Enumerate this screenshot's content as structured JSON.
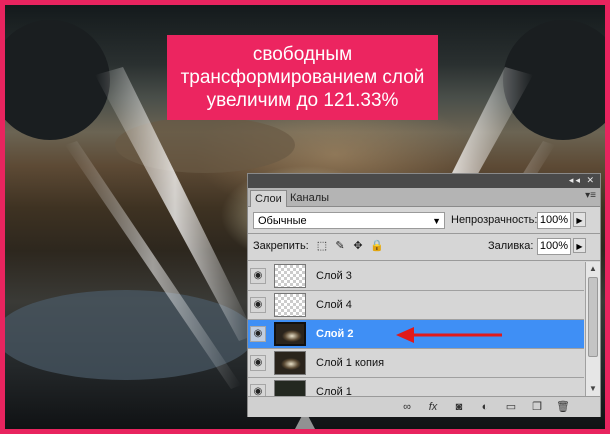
{
  "banner": {
    "line1": "свободным",
    "line2": "трансформированием слой",
    "line3": "увеличим до 121.33%"
  },
  "panel": {
    "titlebar_icons": "◂◂ ✕",
    "tabs": [
      {
        "label": "Слои",
        "active": true
      },
      {
        "label": "Каналы",
        "active": false
      }
    ],
    "menu_icon": "▾≡",
    "blend_mode": "Обычные",
    "opacity_label": "Непрозрачность:",
    "opacity_value": "100%",
    "lock_label": "Закрепить:",
    "fill_label": "Заливка:",
    "fill_value": "100%",
    "lock_icons": [
      "lock-transparent-icon",
      "lock-brush-icon",
      "lock-move-icon",
      "lock-all-icon"
    ]
  },
  "layers": [
    {
      "name": "Слой 3",
      "thumb": "transparent",
      "selected": false
    },
    {
      "name": "Слой 4",
      "thumb": "transparent",
      "selected": false
    },
    {
      "name": "Слой 2",
      "thumb": "image",
      "selected": true
    },
    {
      "name": "Слой 1 копия",
      "thumb": "image",
      "selected": false
    },
    {
      "name": "Слой 1",
      "thumb": "dark",
      "selected": false
    }
  ],
  "footer_icons": [
    "link-icon",
    "fx-icon",
    "mask-icon",
    "adjustment-icon",
    "group-icon",
    "new-layer-icon",
    "trash-icon"
  ],
  "colors": {
    "accent": "#ec2560",
    "selection": "#3f8ff5",
    "arrow": "#e01a1a"
  }
}
